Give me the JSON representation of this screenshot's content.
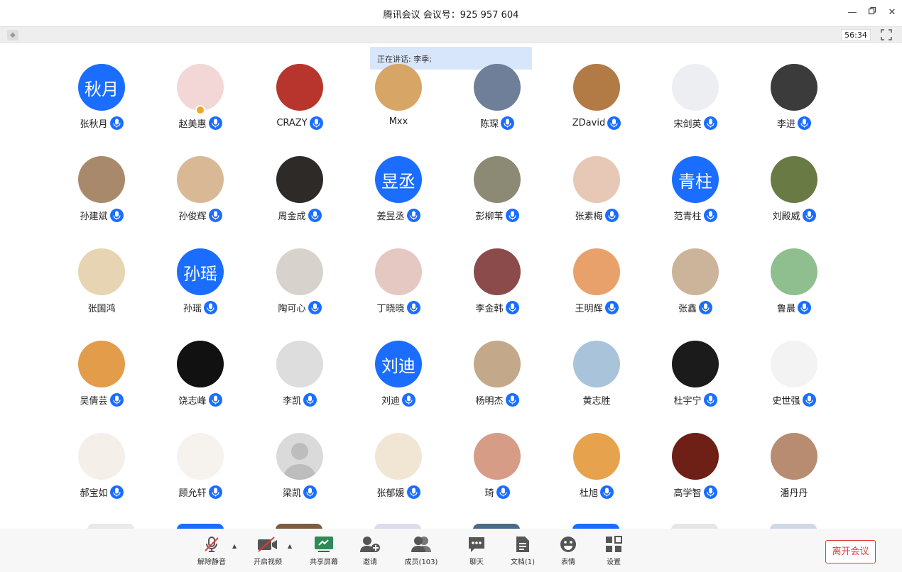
{
  "window": {
    "title": "腾讯会议 会议号：925 957 604"
  },
  "subbar": {
    "timer": "56:34"
  },
  "speaking": {
    "text": "正在讲话: 李季;"
  },
  "colors": {
    "accent": "#1a6dff",
    "leave": "#e53935"
  },
  "participants": [
    {
      "name": "张秋月",
      "initials": "秋月",
      "color": "#1a6dff",
      "mic": true
    },
    {
      "name": "赵美惠",
      "initials": "",
      "color": "#f3d7d7",
      "mic": true,
      "host": true
    },
    {
      "name": "CRAZY",
      "initials": "",
      "color": "#b8352e",
      "mic": true
    },
    {
      "name": "Mxx",
      "initials": "",
      "color": "#d7a566",
      "mic": false
    },
    {
      "name": "陈琛",
      "initials": "",
      "color": "#6f7f99",
      "mic": true
    },
    {
      "name": "ZDavid",
      "initials": "",
      "color": "#b27a45",
      "mic": true
    },
    {
      "name": "宋剑英",
      "initials": "",
      "color": "#eceef2",
      "mic": true
    },
    {
      "name": "李进",
      "initials": "",
      "color": "#3b3b3b",
      "mic": true
    },
    {
      "name": "孙建斌",
      "initials": "",
      "color": "#a9896b",
      "mic": true
    },
    {
      "name": "孙俊辉",
      "initials": "",
      "color": "#d9b896",
      "mic": true
    },
    {
      "name": "周金成",
      "initials": "",
      "color": "#2d2a27",
      "mic": true
    },
    {
      "name": "姜昱丞",
      "initials": "昱丞",
      "color": "#1a6dff",
      "mic": true
    },
    {
      "name": "彭柳苇",
      "initials": "",
      "color": "#8c8a74",
      "mic": true
    },
    {
      "name": "张素梅",
      "initials": "",
      "color": "#e7c7b6",
      "mic": true
    },
    {
      "name": "范青柱",
      "initials": "青柱",
      "color": "#1a6dff",
      "mic": true
    },
    {
      "name": "刘殿威",
      "initials": "",
      "color": "#6a7a45",
      "mic": true
    },
    {
      "name": "张国鸿",
      "initials": "",
      "color": "#e7d4b2",
      "mic": false
    },
    {
      "name": "孙瑶",
      "initials": "孙瑶",
      "color": "#1a6dff",
      "mic": true
    },
    {
      "name": "陶可心",
      "initials": "",
      "color": "#d7d2cb",
      "mic": true
    },
    {
      "name": "丁晓晓",
      "initials": "",
      "color": "#e5c8c1",
      "mic": true
    },
    {
      "name": "李金韩",
      "initials": "",
      "color": "#8b4b4b",
      "mic": true
    },
    {
      "name": "王明辉",
      "initials": "",
      "color": "#e8a16b",
      "mic": true
    },
    {
      "name": "张鑫",
      "initials": "",
      "color": "#cbb49a",
      "mic": true
    },
    {
      "name": "鲁晨",
      "initials": "",
      "color": "#8fbf8e",
      "mic": true
    },
    {
      "name": "吴倩芸",
      "initials": "",
      "color": "#e39c4a",
      "mic": true
    },
    {
      "name": "饶志峰",
      "initials": "",
      "color": "#111111",
      "mic": true
    },
    {
      "name": "李凯",
      "initials": "",
      "color": "#ddd",
      "mic": true
    },
    {
      "name": "刘迪",
      "initials": "刘迪",
      "color": "#1a6dff",
      "mic": true
    },
    {
      "name": "杨明杰",
      "initials": "",
      "color": "#c3a88a",
      "mic": true
    },
    {
      "name": "黄志胜",
      "initials": "",
      "color": "#a9c4da",
      "mic": false
    },
    {
      "name": "杜宇宁",
      "initials": "",
      "color": "#1b1b1b",
      "mic": true
    },
    {
      "name": "史世强",
      "initials": "",
      "color": "#f3f3f3",
      "mic": true
    },
    {
      "name": "郝宝如",
      "initials": "",
      "color": "#f4efe9",
      "mic": true
    },
    {
      "name": "顾允轩",
      "initials": "",
      "color": "#f6f3ef",
      "mic": true
    },
    {
      "name": "梁凯",
      "initials": "",
      "color": "#dadada",
      "mic": true
    },
    {
      "name": "张郁媛",
      "initials": "",
      "color": "#f1e6d4",
      "mic": true
    },
    {
      "name": "琦",
      "initials": "",
      "color": "#d79c86",
      "mic": true
    },
    {
      "name": "杜旭",
      "initials": "",
      "color": "#e7a24d",
      "mic": true
    },
    {
      "name": "高学智",
      "initials": "",
      "color": "#6e1f16",
      "mic": true
    },
    {
      "name": "潘丹丹",
      "initials": "",
      "color": "#b88c71",
      "mic": false
    }
  ],
  "toolbar": {
    "mute": "解除静音",
    "video": "开启视频",
    "share": "共享屏幕",
    "invite": "邀请",
    "members": "成员(103)",
    "chat": "聊天",
    "docs": "文档(1)",
    "emoji": "表情",
    "settings": "设置",
    "leave": "离开会议"
  }
}
